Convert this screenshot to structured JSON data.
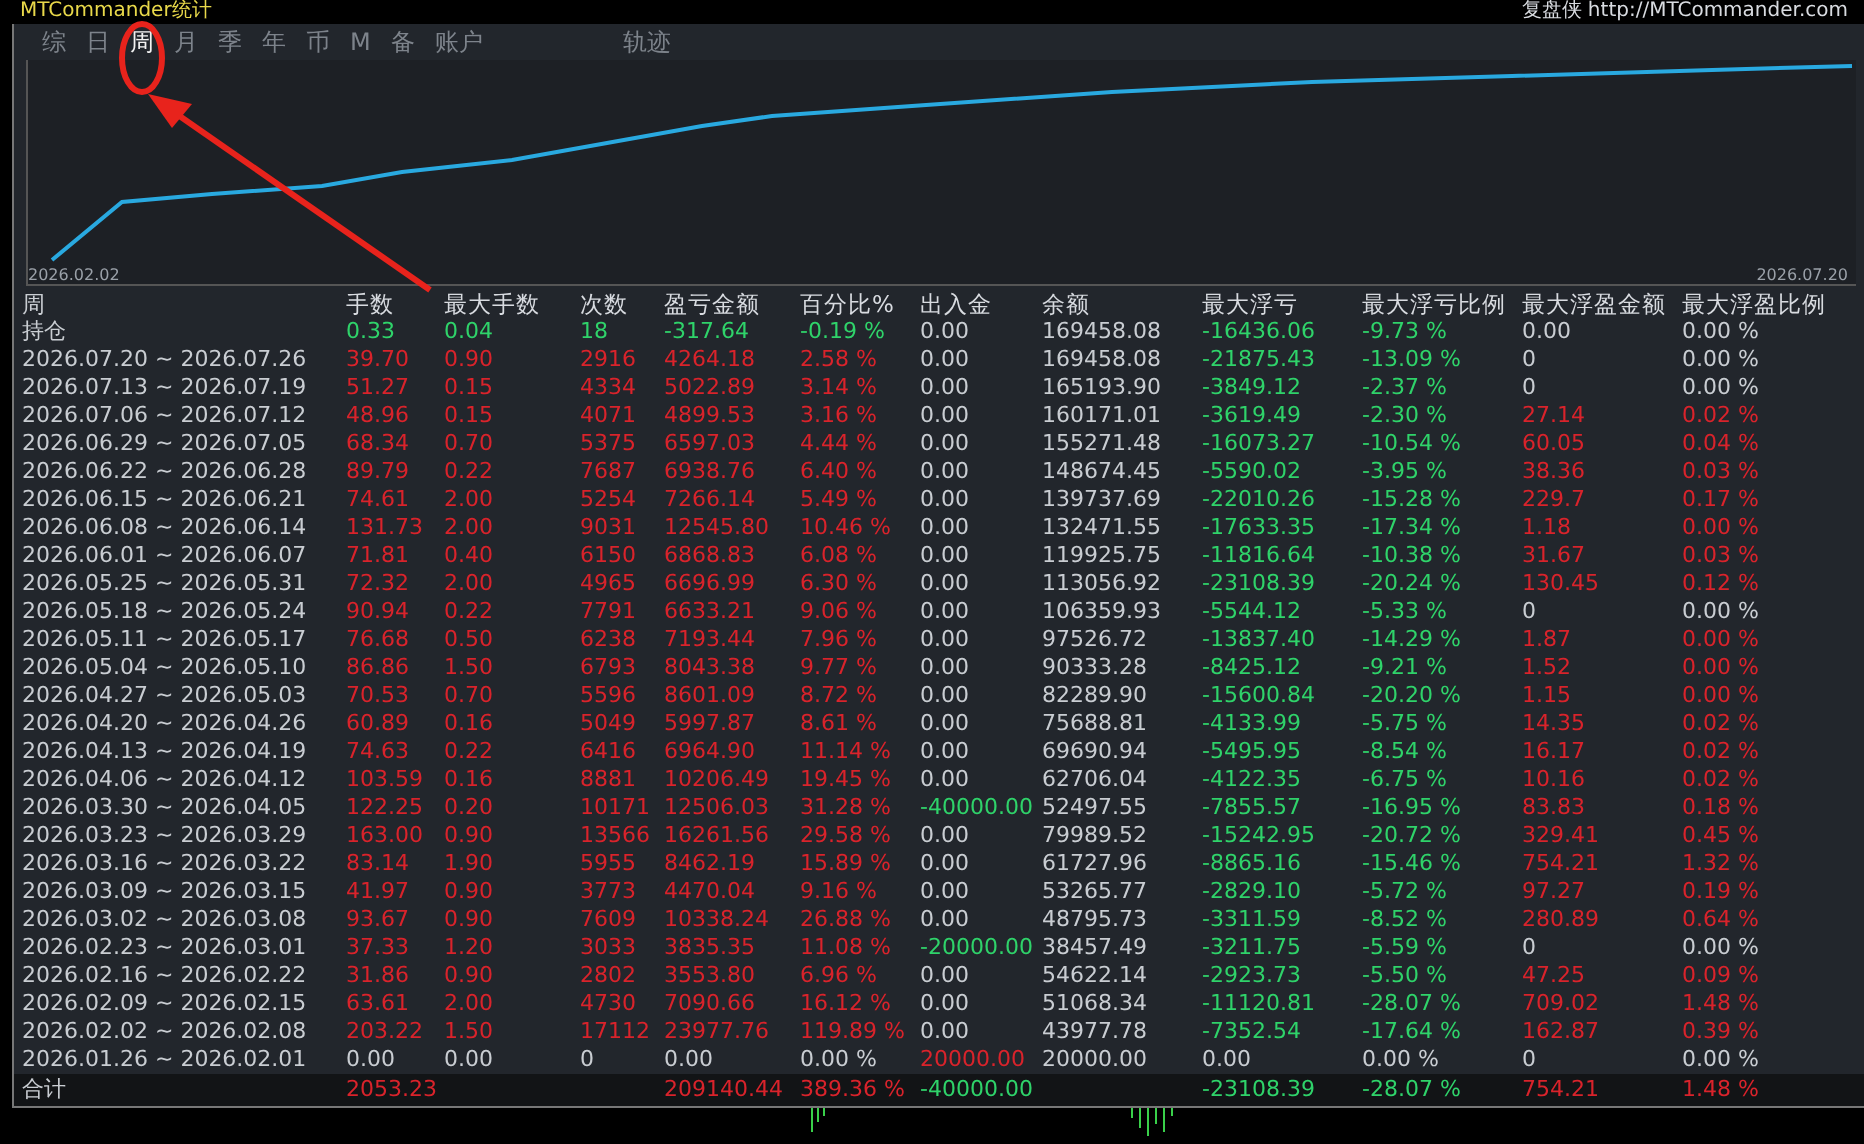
{
  "window": {
    "title": "MTCommander统计",
    "brand": "复盘侠 http://MTCommander.com"
  },
  "tabs": [
    {
      "label": "综",
      "selected": false
    },
    {
      "label": "日",
      "selected": false
    },
    {
      "label": "周",
      "selected": true
    },
    {
      "label": "月",
      "selected": false
    },
    {
      "label": "季",
      "selected": false
    },
    {
      "label": "年",
      "selected": false
    },
    {
      "label": "币",
      "selected": false
    },
    {
      "label": "M",
      "selected": false
    },
    {
      "label": "备",
      "selected": false
    },
    {
      "label": "账户",
      "selected": false
    },
    {
      "label": "轨迹",
      "selected": false
    }
  ],
  "chart": {
    "start_label": "2026.02.02",
    "end_label": "2026.07.20"
  },
  "table": {
    "period_heading": "周",
    "columns": [
      "手数",
      "最大手数",
      "次数",
      "盈亏金额",
      "百分比%",
      "出入金",
      "余额",
      "最大浮亏",
      "最大浮亏比例",
      "最大浮盈金额",
      "最大浮盈比例"
    ],
    "rows": [
      {
        "label": "持仓",
        "cells": [
          {
            "text": "0.33",
            "color": "#2fd36a"
          },
          {
            "text": "0.04",
            "color": "#2fd36a"
          },
          {
            "text": "18",
            "color": "#2fd36a"
          },
          {
            "text": "-317.64",
            "color": "#2fd36a"
          },
          {
            "text": "-0.19 %",
            "color": "#2fd36a"
          },
          {
            "text": "0.00",
            "color": "#c9cdd2"
          },
          {
            "text": "169458.08",
            "color": "#c9cdd2"
          },
          {
            "text": "-16436.06",
            "color": "#2fd36a"
          },
          {
            "text": "-9.73 %",
            "color": "#2fd36a"
          },
          {
            "text": "0.00",
            "color": "#c9cdd2"
          },
          {
            "text": "0.00 %",
            "color": "#c9cdd2"
          }
        ]
      },
      {
        "label": "2026.07.20 ~ 2026.07.26",
        "cells": [
          {
            "text": "39.70",
            "color": "#d9232b"
          },
          {
            "text": "0.90",
            "color": "#d9232b"
          },
          {
            "text": "2916",
            "color": "#d9232b"
          },
          {
            "text": "4264.18",
            "color": "#d9232b"
          },
          {
            "text": "2.58 %",
            "color": "#d9232b"
          },
          {
            "text": "0.00",
            "color": "#c9cdd2"
          },
          {
            "text": "169458.08",
            "color": "#c9cdd2"
          },
          {
            "text": "-21875.43",
            "color": "#2fd36a"
          },
          {
            "text": "-13.09 %",
            "color": "#2fd36a"
          },
          {
            "text": "0",
            "color": "#c9cdd2"
          },
          {
            "text": "0.00 %",
            "color": "#c9cdd2"
          }
        ]
      },
      {
        "label": "2026.07.13 ~ 2026.07.19",
        "cells": [
          {
            "text": "51.27",
            "color": "#d9232b"
          },
          {
            "text": "0.15",
            "color": "#d9232b"
          },
          {
            "text": "4334",
            "color": "#d9232b"
          },
          {
            "text": "5022.89",
            "color": "#d9232b"
          },
          {
            "text": "3.14 %",
            "color": "#d9232b"
          },
          {
            "text": "0.00",
            "color": "#c9cdd2"
          },
          {
            "text": "165193.90",
            "color": "#c9cdd2"
          },
          {
            "text": "-3849.12",
            "color": "#2fd36a"
          },
          {
            "text": "-2.37 %",
            "color": "#2fd36a"
          },
          {
            "text": "0",
            "color": "#c9cdd2"
          },
          {
            "text": "0.00 %",
            "color": "#c9cdd2"
          }
        ]
      },
      {
        "label": "2026.07.06 ~ 2026.07.12",
        "cells": [
          {
            "text": "48.96",
            "color": "#d9232b"
          },
          {
            "text": "0.15",
            "color": "#d9232b"
          },
          {
            "text": "4071",
            "color": "#d9232b"
          },
          {
            "text": "4899.53",
            "color": "#d9232b"
          },
          {
            "text": "3.16 %",
            "color": "#d9232b"
          },
          {
            "text": "0.00",
            "color": "#c9cdd2"
          },
          {
            "text": "160171.01",
            "color": "#c9cdd2"
          },
          {
            "text": "-3619.49",
            "color": "#2fd36a"
          },
          {
            "text": "-2.30 %",
            "color": "#2fd36a"
          },
          {
            "text": "27.14",
            "color": "#d9232b"
          },
          {
            "text": "0.02 %",
            "color": "#d9232b"
          }
        ]
      },
      {
        "label": "2026.06.29 ~ 2026.07.05",
        "cells": [
          {
            "text": "68.34",
            "color": "#d9232b"
          },
          {
            "text": "0.70",
            "color": "#d9232b"
          },
          {
            "text": "5375",
            "color": "#d9232b"
          },
          {
            "text": "6597.03",
            "color": "#d9232b"
          },
          {
            "text": "4.44 %",
            "color": "#d9232b"
          },
          {
            "text": "0.00",
            "color": "#c9cdd2"
          },
          {
            "text": "155271.48",
            "color": "#c9cdd2"
          },
          {
            "text": "-16073.27",
            "color": "#2fd36a"
          },
          {
            "text": "-10.54 %",
            "color": "#2fd36a"
          },
          {
            "text": "60.05",
            "color": "#d9232b"
          },
          {
            "text": "0.04 %",
            "color": "#d9232b"
          }
        ]
      },
      {
        "label": "2026.06.22 ~ 2026.06.28",
        "cells": [
          {
            "text": "89.79",
            "color": "#d9232b"
          },
          {
            "text": "0.22",
            "color": "#d9232b"
          },
          {
            "text": "7687",
            "color": "#d9232b"
          },
          {
            "text": "6938.76",
            "color": "#d9232b"
          },
          {
            "text": "6.40 %",
            "color": "#d9232b"
          },
          {
            "text": "0.00",
            "color": "#c9cdd2"
          },
          {
            "text": "148674.45",
            "color": "#c9cdd2"
          },
          {
            "text": "-5590.02",
            "color": "#2fd36a"
          },
          {
            "text": "-3.95 %",
            "color": "#2fd36a"
          },
          {
            "text": "38.36",
            "color": "#d9232b"
          },
          {
            "text": "0.03 %",
            "color": "#d9232b"
          }
        ]
      },
      {
        "label": "2026.06.15 ~ 2026.06.21",
        "cells": [
          {
            "text": "74.61",
            "color": "#d9232b"
          },
          {
            "text": "2.00",
            "color": "#d9232b"
          },
          {
            "text": "5254",
            "color": "#d9232b"
          },
          {
            "text": "7266.14",
            "color": "#d9232b"
          },
          {
            "text": "5.49 %",
            "color": "#d9232b"
          },
          {
            "text": "0.00",
            "color": "#c9cdd2"
          },
          {
            "text": "139737.69",
            "color": "#c9cdd2"
          },
          {
            "text": "-22010.26",
            "color": "#2fd36a"
          },
          {
            "text": "-15.28 %",
            "color": "#2fd36a"
          },
          {
            "text": "229.7",
            "color": "#d9232b"
          },
          {
            "text": "0.17 %",
            "color": "#d9232b"
          }
        ]
      },
      {
        "label": "2026.06.08 ~ 2026.06.14",
        "cells": [
          {
            "text": "131.73",
            "color": "#d9232b"
          },
          {
            "text": "2.00",
            "color": "#d9232b"
          },
          {
            "text": "9031",
            "color": "#d9232b"
          },
          {
            "text": "12545.80",
            "color": "#d9232b"
          },
          {
            "text": "10.46 %",
            "color": "#d9232b"
          },
          {
            "text": "0.00",
            "color": "#c9cdd2"
          },
          {
            "text": "132471.55",
            "color": "#c9cdd2"
          },
          {
            "text": "-17633.35",
            "color": "#2fd36a"
          },
          {
            "text": "-17.34 %",
            "color": "#2fd36a"
          },
          {
            "text": "1.18",
            "color": "#d9232b"
          },
          {
            "text": "0.00 %",
            "color": "#d9232b"
          }
        ]
      },
      {
        "label": "2026.06.01 ~ 2026.06.07",
        "cells": [
          {
            "text": "71.81",
            "color": "#d9232b"
          },
          {
            "text": "0.40",
            "color": "#d9232b"
          },
          {
            "text": "6150",
            "color": "#d9232b"
          },
          {
            "text": "6868.83",
            "color": "#d9232b"
          },
          {
            "text": "6.08 %",
            "color": "#d9232b"
          },
          {
            "text": "0.00",
            "color": "#c9cdd2"
          },
          {
            "text": "119925.75",
            "color": "#c9cdd2"
          },
          {
            "text": "-11816.64",
            "color": "#2fd36a"
          },
          {
            "text": "-10.38 %",
            "color": "#2fd36a"
          },
          {
            "text": "31.67",
            "color": "#d9232b"
          },
          {
            "text": "0.03 %",
            "color": "#d9232b"
          }
        ]
      },
      {
        "label": "2026.05.25 ~ 2026.05.31",
        "cells": [
          {
            "text": "72.32",
            "color": "#d9232b"
          },
          {
            "text": "2.00",
            "color": "#d9232b"
          },
          {
            "text": "4965",
            "color": "#d9232b"
          },
          {
            "text": "6696.99",
            "color": "#d9232b"
          },
          {
            "text": "6.30 %",
            "color": "#d9232b"
          },
          {
            "text": "0.00",
            "color": "#c9cdd2"
          },
          {
            "text": "113056.92",
            "color": "#c9cdd2"
          },
          {
            "text": "-23108.39",
            "color": "#2fd36a"
          },
          {
            "text": "-20.24 %",
            "color": "#2fd36a"
          },
          {
            "text": "130.45",
            "color": "#d9232b"
          },
          {
            "text": "0.12 %",
            "color": "#d9232b"
          }
        ]
      },
      {
        "label": "2026.05.18 ~ 2026.05.24",
        "cells": [
          {
            "text": "90.94",
            "color": "#d9232b"
          },
          {
            "text": "0.22",
            "color": "#d9232b"
          },
          {
            "text": "7791",
            "color": "#d9232b"
          },
          {
            "text": "6633.21",
            "color": "#d9232b"
          },
          {
            "text": "9.06 %",
            "color": "#d9232b"
          },
          {
            "text": "0.00",
            "color": "#c9cdd2"
          },
          {
            "text": "106359.93",
            "color": "#c9cdd2"
          },
          {
            "text": "-5544.12",
            "color": "#2fd36a"
          },
          {
            "text": "-5.33 %",
            "color": "#2fd36a"
          },
          {
            "text": "0",
            "color": "#c9cdd2"
          },
          {
            "text": "0.00 %",
            "color": "#c9cdd2"
          }
        ]
      },
      {
        "label": "2026.05.11 ~ 2026.05.17",
        "cells": [
          {
            "text": "76.68",
            "color": "#d9232b"
          },
          {
            "text": "0.50",
            "color": "#d9232b"
          },
          {
            "text": "6238",
            "color": "#d9232b"
          },
          {
            "text": "7193.44",
            "color": "#d9232b"
          },
          {
            "text": "7.96 %",
            "color": "#d9232b"
          },
          {
            "text": "0.00",
            "color": "#c9cdd2"
          },
          {
            "text": "97526.72",
            "color": "#c9cdd2"
          },
          {
            "text": "-13837.40",
            "color": "#2fd36a"
          },
          {
            "text": "-14.29 %",
            "color": "#2fd36a"
          },
          {
            "text": "1.87",
            "color": "#d9232b"
          },
          {
            "text": "0.00 %",
            "color": "#d9232b"
          }
        ]
      },
      {
        "label": "2026.05.04 ~ 2026.05.10",
        "cells": [
          {
            "text": "86.86",
            "color": "#d9232b"
          },
          {
            "text": "1.50",
            "color": "#d9232b"
          },
          {
            "text": "6793",
            "color": "#d9232b"
          },
          {
            "text": "8043.38",
            "color": "#d9232b"
          },
          {
            "text": "9.77 %",
            "color": "#d9232b"
          },
          {
            "text": "0.00",
            "color": "#c9cdd2"
          },
          {
            "text": "90333.28",
            "color": "#c9cdd2"
          },
          {
            "text": "-8425.12",
            "color": "#2fd36a"
          },
          {
            "text": "-9.21 %",
            "color": "#2fd36a"
          },
          {
            "text": "1.52",
            "color": "#d9232b"
          },
          {
            "text": "0.00 %",
            "color": "#d9232b"
          }
        ]
      },
      {
        "label": "2026.04.27 ~ 2026.05.03",
        "cells": [
          {
            "text": "70.53",
            "color": "#d9232b"
          },
          {
            "text": "0.70",
            "color": "#d9232b"
          },
          {
            "text": "5596",
            "color": "#d9232b"
          },
          {
            "text": "8601.09",
            "color": "#d9232b"
          },
          {
            "text": "8.72 %",
            "color": "#d9232b"
          },
          {
            "text": "0.00",
            "color": "#c9cdd2"
          },
          {
            "text": "82289.90",
            "color": "#c9cdd2"
          },
          {
            "text": "-15600.84",
            "color": "#2fd36a"
          },
          {
            "text": "-20.20 %",
            "color": "#2fd36a"
          },
          {
            "text": "1.15",
            "color": "#d9232b"
          },
          {
            "text": "0.00 %",
            "color": "#d9232b"
          }
        ]
      },
      {
        "label": "2026.04.20 ~ 2026.04.26",
        "cells": [
          {
            "text": "60.89",
            "color": "#d9232b"
          },
          {
            "text": "0.16",
            "color": "#d9232b"
          },
          {
            "text": "5049",
            "color": "#d9232b"
          },
          {
            "text": "5997.87",
            "color": "#d9232b"
          },
          {
            "text": "8.61 %",
            "color": "#d9232b"
          },
          {
            "text": "0.00",
            "color": "#c9cdd2"
          },
          {
            "text": "75688.81",
            "color": "#c9cdd2"
          },
          {
            "text": "-4133.99",
            "color": "#2fd36a"
          },
          {
            "text": "-5.75 %",
            "color": "#2fd36a"
          },
          {
            "text": "14.35",
            "color": "#d9232b"
          },
          {
            "text": "0.02 %",
            "color": "#d9232b"
          }
        ]
      },
      {
        "label": "2026.04.13 ~ 2026.04.19",
        "cells": [
          {
            "text": "74.63",
            "color": "#d9232b"
          },
          {
            "text": "0.22",
            "color": "#d9232b"
          },
          {
            "text": "6416",
            "color": "#d9232b"
          },
          {
            "text": "6964.90",
            "color": "#d9232b"
          },
          {
            "text": "11.14 %",
            "color": "#d9232b"
          },
          {
            "text": "0.00",
            "color": "#c9cdd2"
          },
          {
            "text": "69690.94",
            "color": "#c9cdd2"
          },
          {
            "text": "-5495.95",
            "color": "#2fd36a"
          },
          {
            "text": "-8.54 %",
            "color": "#2fd36a"
          },
          {
            "text": "16.17",
            "color": "#d9232b"
          },
          {
            "text": "0.02 %",
            "color": "#d9232b"
          }
        ]
      },
      {
        "label": "2026.04.06 ~ 2026.04.12",
        "cells": [
          {
            "text": "103.59",
            "color": "#d9232b"
          },
          {
            "text": "0.16",
            "color": "#d9232b"
          },
          {
            "text": "8881",
            "color": "#d9232b"
          },
          {
            "text": "10206.49",
            "color": "#d9232b"
          },
          {
            "text": "19.45 %",
            "color": "#d9232b"
          },
          {
            "text": "0.00",
            "color": "#c9cdd2"
          },
          {
            "text": "62706.04",
            "color": "#c9cdd2"
          },
          {
            "text": "-4122.35",
            "color": "#2fd36a"
          },
          {
            "text": "-6.75 %",
            "color": "#2fd36a"
          },
          {
            "text": "10.16",
            "color": "#d9232b"
          },
          {
            "text": "0.02 %",
            "color": "#d9232b"
          }
        ]
      },
      {
        "label": "2026.03.30 ~ 2026.04.05",
        "cells": [
          {
            "text": "122.25",
            "color": "#d9232b"
          },
          {
            "text": "0.20",
            "color": "#d9232b"
          },
          {
            "text": "10171",
            "color": "#d9232b"
          },
          {
            "text": "12506.03",
            "color": "#d9232b"
          },
          {
            "text": "31.28 %",
            "color": "#d9232b"
          },
          {
            "text": "-40000.00",
            "color": "#2fd36a"
          },
          {
            "text": "52497.55",
            "color": "#c9cdd2"
          },
          {
            "text": "-7855.57",
            "color": "#2fd36a"
          },
          {
            "text": "-16.95 %",
            "color": "#2fd36a"
          },
          {
            "text": "83.83",
            "color": "#d9232b"
          },
          {
            "text": "0.18 %",
            "color": "#d9232b"
          }
        ]
      },
      {
        "label": "2026.03.23 ~ 2026.03.29",
        "cells": [
          {
            "text": "163.00",
            "color": "#d9232b"
          },
          {
            "text": "0.90",
            "color": "#d9232b"
          },
          {
            "text": "13566",
            "color": "#d9232b"
          },
          {
            "text": "16261.56",
            "color": "#d9232b"
          },
          {
            "text": "29.58 %",
            "color": "#d9232b"
          },
          {
            "text": "0.00",
            "color": "#c9cdd2"
          },
          {
            "text": "79989.52",
            "color": "#c9cdd2"
          },
          {
            "text": "-15242.95",
            "color": "#2fd36a"
          },
          {
            "text": "-20.72 %",
            "color": "#2fd36a"
          },
          {
            "text": "329.41",
            "color": "#d9232b"
          },
          {
            "text": "0.45 %",
            "color": "#d9232b"
          }
        ]
      },
      {
        "label": "2026.03.16 ~ 2026.03.22",
        "cells": [
          {
            "text": "83.14",
            "color": "#d9232b"
          },
          {
            "text": "1.90",
            "color": "#d9232b"
          },
          {
            "text": "5955",
            "color": "#d9232b"
          },
          {
            "text": "8462.19",
            "color": "#d9232b"
          },
          {
            "text": "15.89 %",
            "color": "#d9232b"
          },
          {
            "text": "0.00",
            "color": "#c9cdd2"
          },
          {
            "text": "61727.96",
            "color": "#c9cdd2"
          },
          {
            "text": "-8865.16",
            "color": "#2fd36a"
          },
          {
            "text": "-15.46 %",
            "color": "#2fd36a"
          },
          {
            "text": "754.21",
            "color": "#d9232b"
          },
          {
            "text": "1.32 %",
            "color": "#d9232b"
          }
        ]
      },
      {
        "label": "2026.03.09 ~ 2026.03.15",
        "cells": [
          {
            "text": "41.97",
            "color": "#d9232b"
          },
          {
            "text": "0.90",
            "color": "#d9232b"
          },
          {
            "text": "3773",
            "color": "#d9232b"
          },
          {
            "text": "4470.04",
            "color": "#d9232b"
          },
          {
            "text": "9.16 %",
            "color": "#d9232b"
          },
          {
            "text": "0.00",
            "color": "#c9cdd2"
          },
          {
            "text": "53265.77",
            "color": "#c9cdd2"
          },
          {
            "text": "-2829.10",
            "color": "#2fd36a"
          },
          {
            "text": "-5.72 %",
            "color": "#2fd36a"
          },
          {
            "text": "97.27",
            "color": "#d9232b"
          },
          {
            "text": "0.19 %",
            "color": "#d9232b"
          }
        ]
      },
      {
        "label": "2026.03.02 ~ 2026.03.08",
        "cells": [
          {
            "text": "93.67",
            "color": "#d9232b"
          },
          {
            "text": "0.90",
            "color": "#d9232b"
          },
          {
            "text": "7609",
            "color": "#d9232b"
          },
          {
            "text": "10338.24",
            "color": "#d9232b"
          },
          {
            "text": "26.88 %",
            "color": "#d9232b"
          },
          {
            "text": "0.00",
            "color": "#c9cdd2"
          },
          {
            "text": "48795.73",
            "color": "#c9cdd2"
          },
          {
            "text": "-3311.59",
            "color": "#2fd36a"
          },
          {
            "text": "-8.52 %",
            "color": "#2fd36a"
          },
          {
            "text": "280.89",
            "color": "#d9232b"
          },
          {
            "text": "0.64 %",
            "color": "#d9232b"
          }
        ]
      },
      {
        "label": "2026.02.23 ~ 2026.03.01",
        "cells": [
          {
            "text": "37.33",
            "color": "#d9232b"
          },
          {
            "text": "1.20",
            "color": "#d9232b"
          },
          {
            "text": "3033",
            "color": "#d9232b"
          },
          {
            "text": "3835.35",
            "color": "#d9232b"
          },
          {
            "text": "11.08 %",
            "color": "#d9232b"
          },
          {
            "text": "-20000.00",
            "color": "#2fd36a"
          },
          {
            "text": "38457.49",
            "color": "#c9cdd2"
          },
          {
            "text": "-3211.75",
            "color": "#2fd36a"
          },
          {
            "text": "-5.59 %",
            "color": "#2fd36a"
          },
          {
            "text": "0",
            "color": "#c9cdd2"
          },
          {
            "text": "0.00 %",
            "color": "#c9cdd2"
          }
        ]
      },
      {
        "label": "2026.02.16 ~ 2026.02.22",
        "cells": [
          {
            "text": "31.86",
            "color": "#d9232b"
          },
          {
            "text": "0.90",
            "color": "#d9232b"
          },
          {
            "text": "2802",
            "color": "#d9232b"
          },
          {
            "text": "3553.80",
            "color": "#d9232b"
          },
          {
            "text": "6.96 %",
            "color": "#d9232b"
          },
          {
            "text": "0.00",
            "color": "#c9cdd2"
          },
          {
            "text": "54622.14",
            "color": "#c9cdd2"
          },
          {
            "text": "-2923.73",
            "color": "#2fd36a"
          },
          {
            "text": "-5.50 %",
            "color": "#2fd36a"
          },
          {
            "text": "47.25",
            "color": "#d9232b"
          },
          {
            "text": "0.09 %",
            "color": "#d9232b"
          }
        ]
      },
      {
        "label": "2026.02.09 ~ 2026.02.15",
        "cells": [
          {
            "text": "63.61",
            "color": "#d9232b"
          },
          {
            "text": "2.00",
            "color": "#d9232b"
          },
          {
            "text": "4730",
            "color": "#d9232b"
          },
          {
            "text": "7090.66",
            "color": "#d9232b"
          },
          {
            "text": "16.12 %",
            "color": "#d9232b"
          },
          {
            "text": "0.00",
            "color": "#c9cdd2"
          },
          {
            "text": "51068.34",
            "color": "#c9cdd2"
          },
          {
            "text": "-11120.81",
            "color": "#2fd36a"
          },
          {
            "text": "-28.07 %",
            "color": "#2fd36a"
          },
          {
            "text": "709.02",
            "color": "#d9232b"
          },
          {
            "text": "1.48 %",
            "color": "#d9232b"
          }
        ]
      },
      {
        "label": "2026.02.02 ~ 2026.02.08",
        "cells": [
          {
            "text": "203.22",
            "color": "#d9232b"
          },
          {
            "text": "1.50",
            "color": "#d9232b"
          },
          {
            "text": "17112",
            "color": "#d9232b"
          },
          {
            "text": "23977.76",
            "color": "#d9232b"
          },
          {
            "text": "119.89 %",
            "color": "#d9232b"
          },
          {
            "text": "0.00",
            "color": "#c9cdd2"
          },
          {
            "text": "43977.78",
            "color": "#c9cdd2"
          },
          {
            "text": "-7352.54",
            "color": "#2fd36a"
          },
          {
            "text": "-17.64 %",
            "color": "#2fd36a"
          },
          {
            "text": "162.87",
            "color": "#d9232b"
          },
          {
            "text": "0.39 %",
            "color": "#d9232b"
          }
        ]
      },
      {
        "label": "2026.01.26 ~ 2026.02.01",
        "cells": [
          {
            "text": "0.00",
            "color": "#c9cdd2"
          },
          {
            "text": "0.00",
            "color": "#c9cdd2"
          },
          {
            "text": "0",
            "color": "#c9cdd2"
          },
          {
            "text": "0.00",
            "color": "#c9cdd2"
          },
          {
            "text": "0.00 %",
            "color": "#c9cdd2"
          },
          {
            "text": "20000.00",
            "color": "#d9232b"
          },
          {
            "text": "20000.00",
            "color": "#c9cdd2"
          },
          {
            "text": "0.00",
            "color": "#c9cdd2"
          },
          {
            "text": "0.00 %",
            "color": "#c9cdd2"
          },
          {
            "text": "0",
            "color": "#c9cdd2"
          },
          {
            "text": "0.00 %",
            "color": "#c9cdd2"
          }
        ]
      }
    ],
    "total": {
      "label": "合计",
      "lots": {
        "text": "2053.23",
        "color": "#d9232b"
      },
      "profit": {
        "text": "209140.44",
        "color": "#d9232b"
      },
      "percent": {
        "text": "389.36 %",
        "color": "#d9232b"
      },
      "transfer": {
        "text": "-40000.00",
        "color": "#2fd36a"
      },
      "max_float_loss": {
        "text": "-23108.39",
        "color": "#2fd36a"
      },
      "max_float_loss_pct": {
        "text": "-28.07 %",
        "color": "#2fd36a"
      },
      "max_float_profit": {
        "text": "754.21",
        "color": "#d9232b"
      },
      "max_float_profit_pct": {
        "text": "1.48 %",
        "color": "#d9232b"
      }
    }
  }
}
